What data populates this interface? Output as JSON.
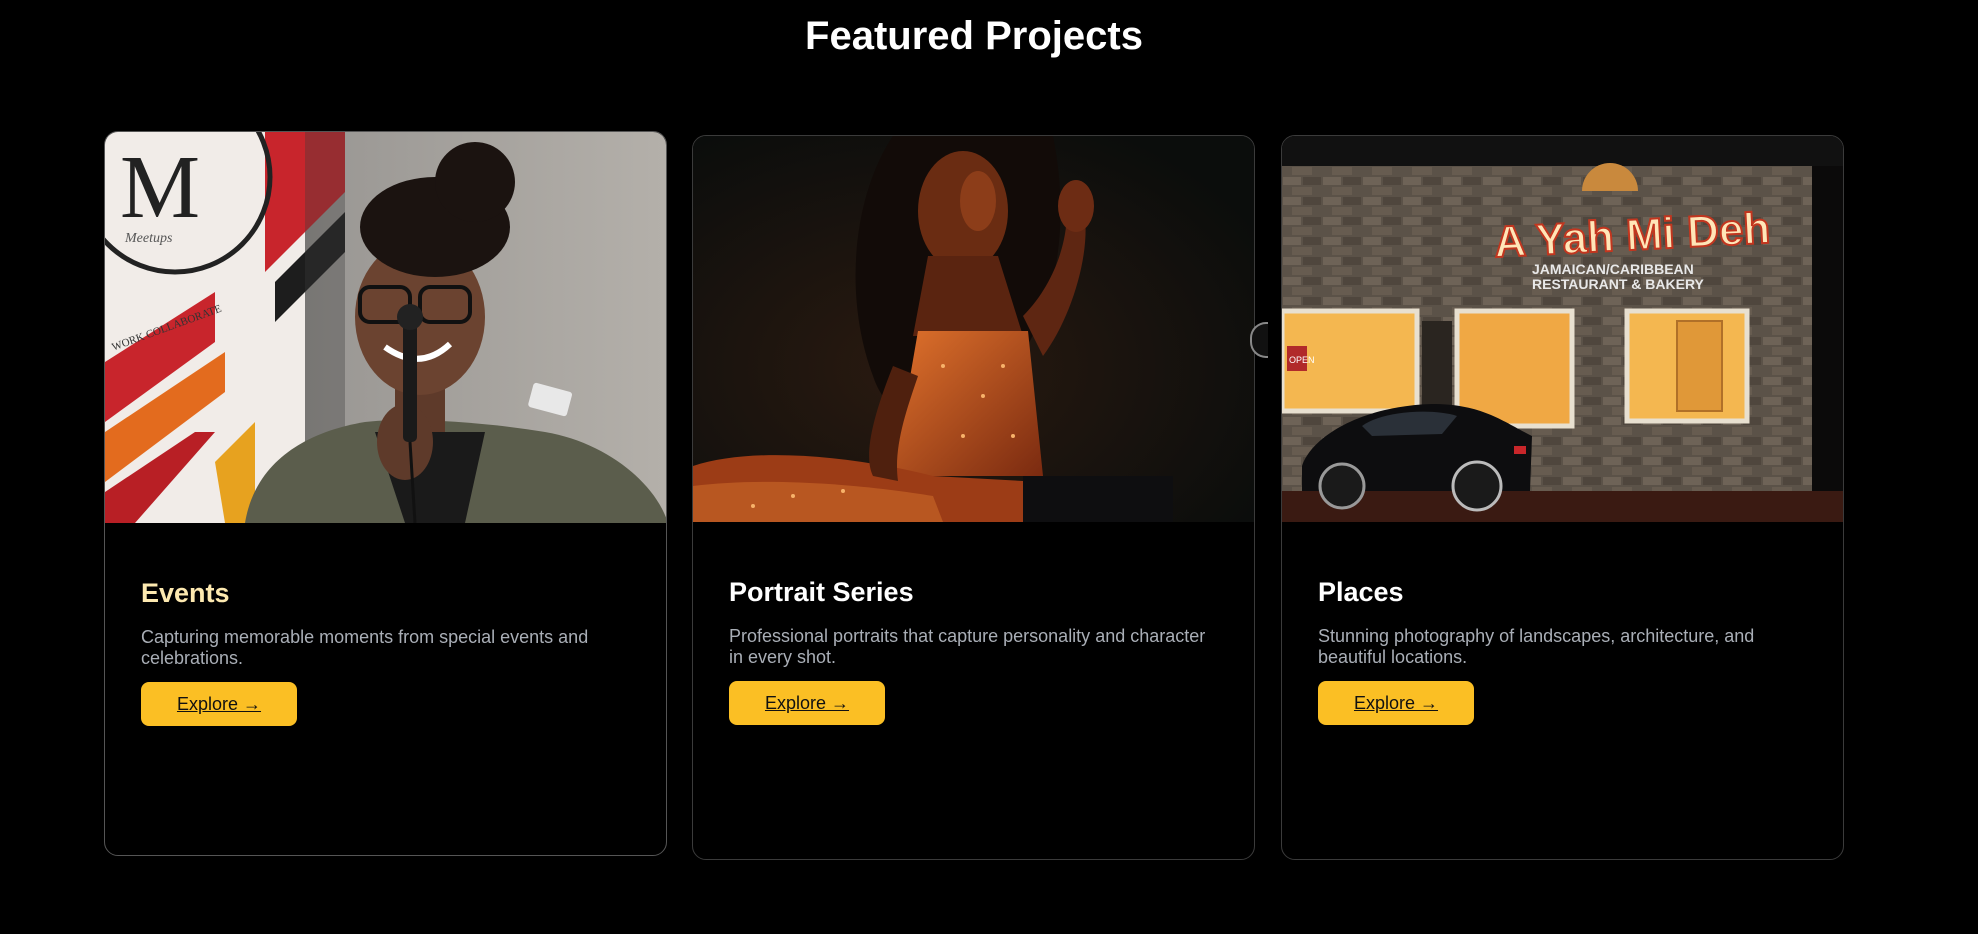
{
  "section": {
    "title": "Featured Projects"
  },
  "cards": [
    {
      "title": "Events",
      "description": "Capturing memorable moments from special events and celebrations.",
      "button_label": "Explore →",
      "image_text": {
        "logo_letter": "M",
        "script_text": "Meetups",
        "arc_text": "WORK COLLABORATE"
      }
    },
    {
      "title": "Portrait Series",
      "description": "Professional portraits that capture personality and character in every shot.",
      "button_label": "Explore →"
    },
    {
      "title": "Places",
      "description": "Stunning photography of landscapes, architecture, and beautiful locations.",
      "button_label": "Explore →",
      "image_text": {
        "sign_main": "A Yah Mi Deh",
        "sign_sub1": "JAMAICAN/CARIBBEAN",
        "sign_sub2": "RESTAURANT & BAKERY",
        "window_sign": "OPEN"
      }
    }
  ],
  "colors": {
    "background": "#000000",
    "accent": "#fbbf24",
    "events_title": "#fde9b0",
    "description": "#a9aeb6"
  }
}
